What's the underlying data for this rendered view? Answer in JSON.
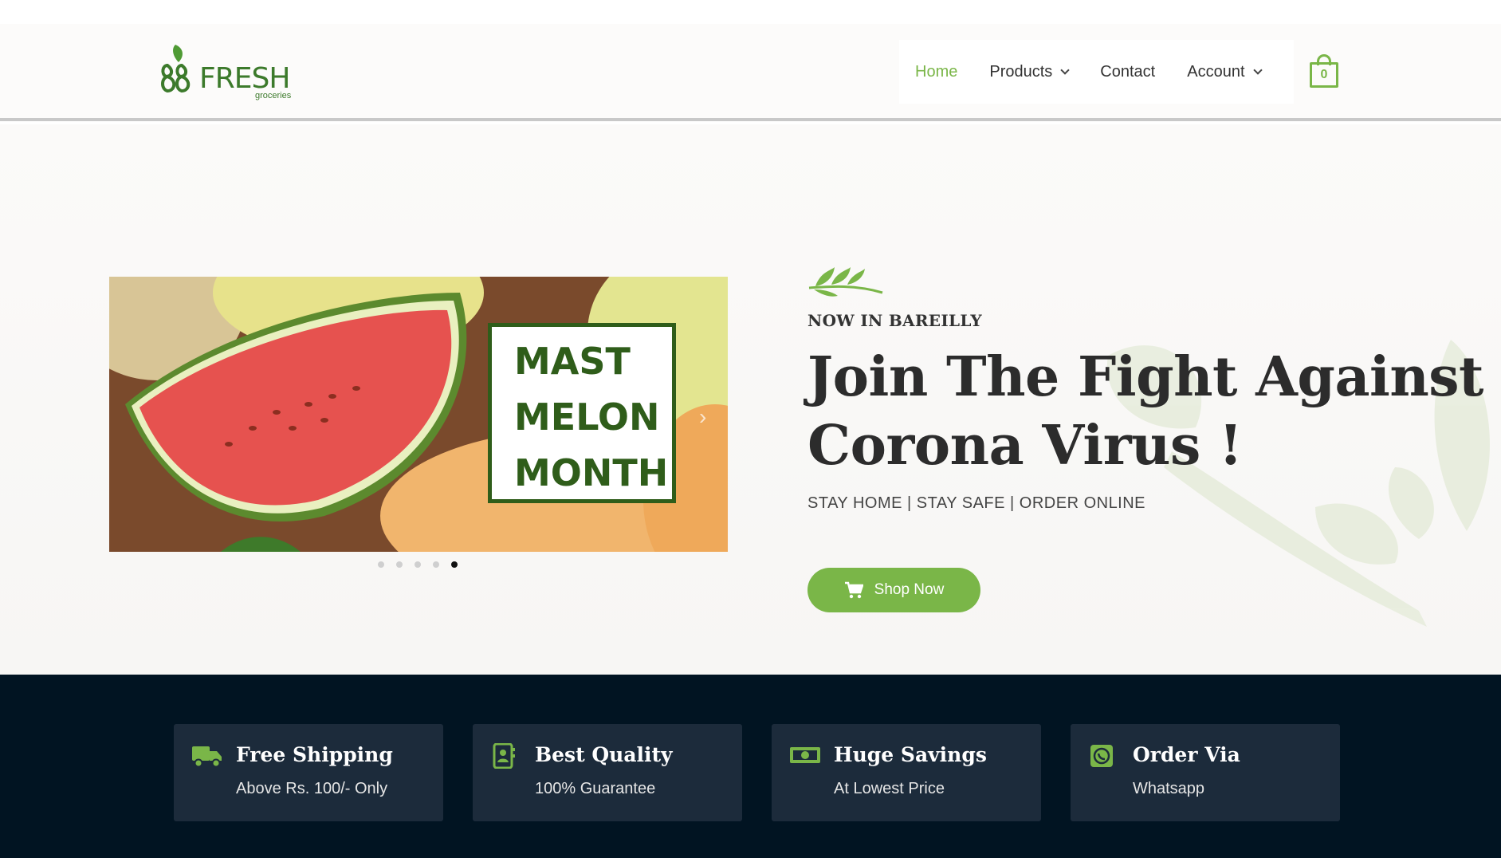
{
  "brand": {
    "name": "FRESH",
    "sub": "groceries",
    "accent": "#7ab648",
    "dark_green": "#2f5d1a"
  },
  "nav": {
    "items": [
      {
        "label": "Home",
        "active": true,
        "dropdown": false
      },
      {
        "label": "Products",
        "active": false,
        "dropdown": true
      },
      {
        "label": "Contact",
        "active": false,
        "dropdown": false
      },
      {
        "label": "Account",
        "active": false,
        "dropdown": true
      }
    ],
    "cart_count": "0",
    "cart_icon": "shopping-bag-icon"
  },
  "hero": {
    "slide": {
      "lines": [
        "MAST",
        "MELON",
        "MONTH"
      ]
    },
    "slider_dots": {
      "count": 5,
      "active_index": 4
    },
    "eyebrow": "NOW IN BAREILLY",
    "headline_line1": "Join The Fight Against",
    "headline_line2": "Corona Virus !",
    "tagline": "STAY HOME | STAY SAFE | ORDER ONLINE",
    "cta_label": "Shop Now",
    "cta_icon": "cart-icon"
  },
  "features": [
    {
      "icon": "truck-icon",
      "title": "Free Shipping",
      "subtitle": "Above Rs. 100/- Only"
    },
    {
      "icon": "contact-book-icon",
      "title": "Best Quality",
      "subtitle": "100% Guarantee"
    },
    {
      "icon": "money-bill-icon",
      "title": "Huge Savings",
      "subtitle": "At Lowest Price"
    },
    {
      "icon": "whatsapp-icon",
      "title": "Order Via",
      "subtitle": "Whatsapp"
    }
  ],
  "colors": {
    "footer_bg": "#011422",
    "card_bg": "#1c2b3b"
  }
}
